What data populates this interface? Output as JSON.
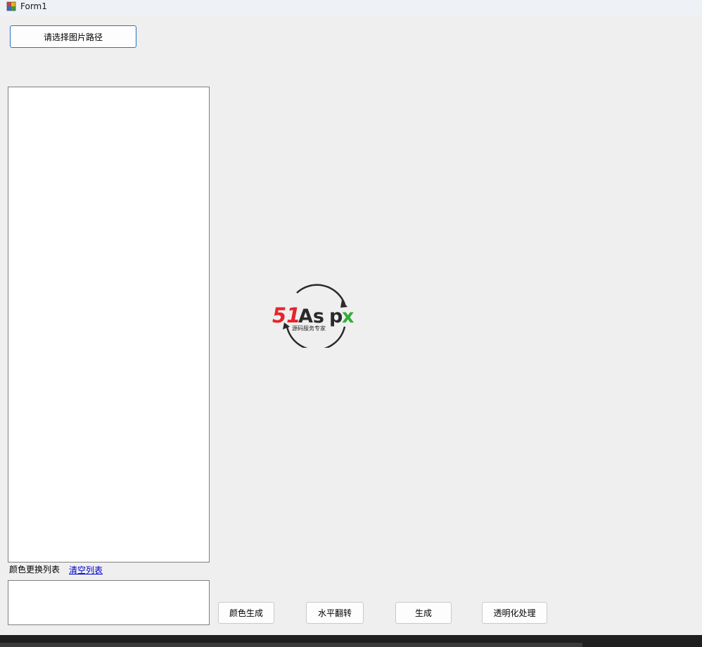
{
  "window": {
    "title": "Form1"
  },
  "buttons": {
    "select_path": "请选择图片路径",
    "color_generate": "颜色生成",
    "horizontal_flip": "水平翻转",
    "generate": "生成",
    "transparency": "透明化处理"
  },
  "labels": {
    "color_replace_list": "颜色更换列表",
    "clear_list": "清空列表"
  },
  "logo": {
    "brand_red": "51",
    "brand_dark": "As",
    "brand_p": "p",
    "brand_green": "x",
    "tagline": "源码服务专家",
    "colors": {
      "red": "#e8232a",
      "dark": "#2a2a2a",
      "green": "#2fae34"
    }
  }
}
